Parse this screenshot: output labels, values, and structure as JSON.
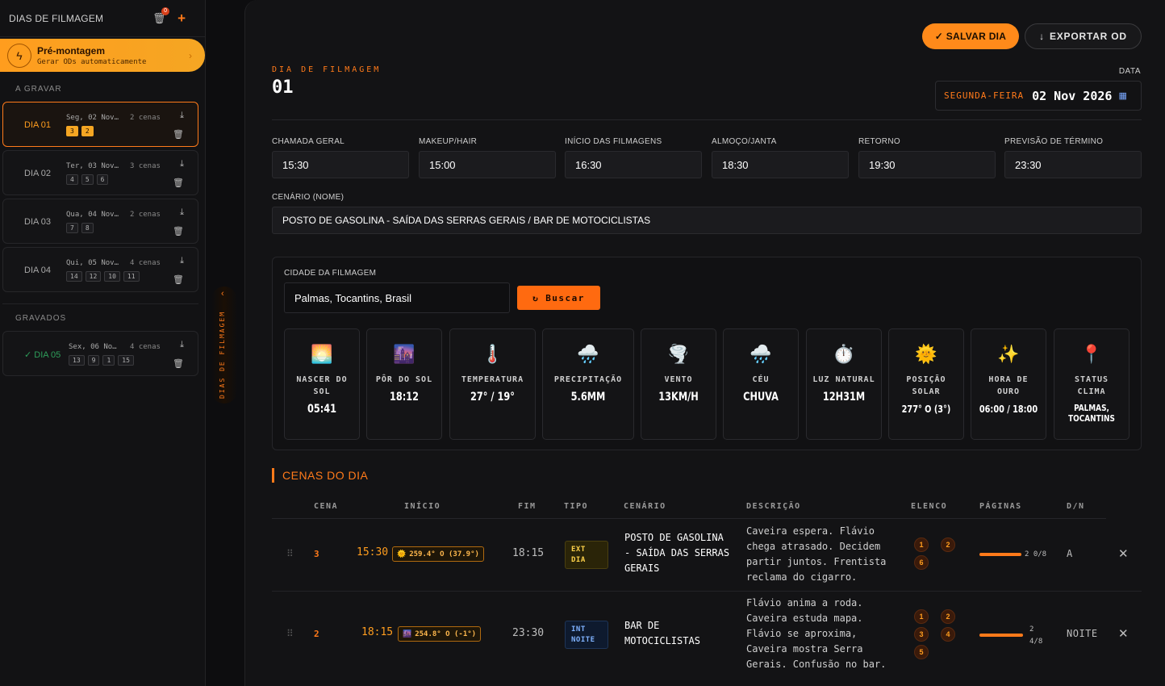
{
  "sidebar": {
    "title": "DIAS DE FILMAGEM",
    "trash_badge": "0",
    "plus": "+",
    "premontagem": {
      "title": "Pré-montagem",
      "subtitle": "Gerar ODs automaticamente"
    },
    "section_to_shoot": "A GRAVAR",
    "section_shot": "GRAVADOS",
    "days": [
      {
        "name": "DIA 01",
        "date": "Seg, 02 Nov…",
        "scenes": "2 cenas",
        "tags": [
          "3",
          "2"
        ]
      },
      {
        "name": "DIA 02",
        "date": "Ter, 03 Nov…",
        "scenes": "3 cenas",
        "tags": [
          "4",
          "5",
          "6"
        ]
      },
      {
        "name": "DIA 03",
        "date": "Qua, 04 Nov…",
        "scenes": "2 cenas",
        "tags": [
          "7",
          "8"
        ]
      },
      {
        "name": "DIA 04",
        "date": "Qui, 05 Nov…",
        "scenes": "4 cenas",
        "tags": [
          "14",
          "12",
          "10",
          "11"
        ]
      }
    ],
    "done_days": [
      {
        "name": "✓ DIA 05",
        "date": "Sex, 06 No…",
        "scenes": "4 cenas",
        "tags": [
          "13",
          "9",
          "1",
          "15"
        ]
      }
    ],
    "rail_label": "DIAS DE FILMAGEM"
  },
  "header": {
    "save_label": "✓ SALVAR DIA",
    "export_label": "EXPORTAR OD",
    "day_label": "DIA DE FILMAGEM",
    "day_number": "01",
    "date_label": "DATA",
    "weekday": "SEGUNDA-FEIRA",
    "date": "02 Nov 2026"
  },
  "times": [
    {
      "label": "CHAMADA GERAL",
      "value": "15:30"
    },
    {
      "label": "MAKEUP/HAIR",
      "value": "15:00"
    },
    {
      "label": "INÍCIO DAS FILMAGENS",
      "value": "16:30"
    },
    {
      "label": "ALMOÇO/JANTA",
      "value": "18:30"
    },
    {
      "label": "RETORNO",
      "value": "19:30"
    },
    {
      "label": "PREVISÃO DE TÉRMINO",
      "value": "23:30"
    }
  ],
  "scenario": {
    "label": "CENÁRIO (NOME)",
    "value": "POSTO DE GASOLINA - SAÍDA DAS SERRAS GERAIS / BAR DE MOTOCICLISTAS"
  },
  "weather": {
    "city_label": "CIDADE DA FILMAGEM",
    "city_value": "Palmas, Tocantins, Brasil",
    "search_label": "Buscar",
    "cards": [
      {
        "icon": "🌅",
        "label": "NASCER DO SOL",
        "value": "05:41"
      },
      {
        "icon": "🌆",
        "label": "PÔR DO SOL",
        "value": "18:12"
      },
      {
        "icon": "🌡️",
        "label": "TEMPERATURA",
        "value": "27° / 19°"
      },
      {
        "icon": "🌧️",
        "label": "PRECIPITAÇÃO",
        "value": "5.6MM"
      },
      {
        "icon": "🌪️",
        "label": "VENTO",
        "value": "13KM/H"
      },
      {
        "icon": "🌧️",
        "label": "CÉU",
        "value": "CHUVA"
      },
      {
        "icon": "⏱️",
        "label": "LUZ NATURAL",
        "value": "12H31M"
      },
      {
        "icon": "🌞",
        "label": "POSIÇÃO SOLAR",
        "value": "277° O (3°)"
      },
      {
        "icon": "✨",
        "label": "HORA DE OURO",
        "value": "06:00 / 18:00"
      },
      {
        "icon": "📍",
        "label": "STATUS CLIMA",
        "value": "PALMAS, TOCANTINS"
      }
    ]
  },
  "scenes": {
    "title": "CENAS DO DIA",
    "columns": [
      "CENA",
      "INÍCIO",
      "FIM",
      "TIPO",
      "CENÁRIO",
      "DESCRIÇÃO",
      "ELENCO",
      "PÁGINAS",
      "D/N"
    ],
    "rows": [
      {
        "cena": "3",
        "inicio": "15:30",
        "sun": "259.4° O (37.9°)",
        "fim": "18:15",
        "tipo1": "EXT",
        "tipo2": "DIA",
        "cenario": "POSTO DE GASOLINA - SAÍDA DAS SERRAS GERAIS",
        "descricao": "Caveira espera. Flávio chega atrasado. Decidem partir juntos. Frentista reclama do cigarro.",
        "elenco": [
          "1",
          "2",
          "6"
        ],
        "paginas": "2 0/8",
        "pages_fraction": 1.0,
        "dn": "A"
      },
      {
        "cena": "2",
        "inicio": "18:15",
        "sun": "254.8° O (-1°)",
        "fim": "23:30",
        "tipo1": "INT",
        "tipo2": "NOITE",
        "cenario": "BAR DE MOTOCICLISTAS",
        "descricao": "Flávio anima a roda. Caveira estuda mapa. Flávio se aproxima, Caveira mostra Serra Gerais. Confusão no bar.",
        "elenco": [
          "1",
          "2",
          "3",
          "4",
          "5"
        ],
        "paginas_line1": "2",
        "paginas_line2": "4/8",
        "pages_fraction": 1.0,
        "dn": "NOITE"
      }
    ]
  }
}
